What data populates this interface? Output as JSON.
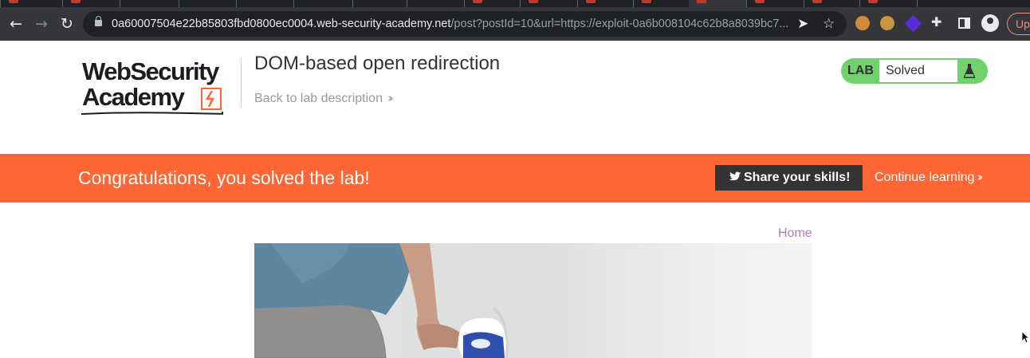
{
  "browser": {
    "url_host": "0a60007504e22b85803fbd0800ec0004.web-security-academy.net",
    "url_path": "/post?postId=10&url=https://exploit-0a6b008104c62b8a8039bc7...",
    "update_label": "Upd",
    "icons": [
      "back-icon",
      "forward-icon",
      "reload-icon",
      "lock-icon",
      "send-icon",
      "star-icon",
      "cookie-icon",
      "cookie-icon",
      "diamond-icon",
      "puzzle-icon",
      "side-panel-icon",
      "profile-icon"
    ]
  },
  "header": {
    "logo_line1": "WebSecurity",
    "logo_line2": "Academy",
    "lab_title": "DOM-based open redirection",
    "back_link": "Back to lab description",
    "status_tag": "LAB",
    "status_value": "Solved",
    "status_color": "#70d16d"
  },
  "banner": {
    "message": "Congratulations, you solved the lab!",
    "share_label": "Share your skills!",
    "continue_label": "Continue learning",
    "color": "#ff6633"
  },
  "content": {
    "home_link": "Home"
  }
}
